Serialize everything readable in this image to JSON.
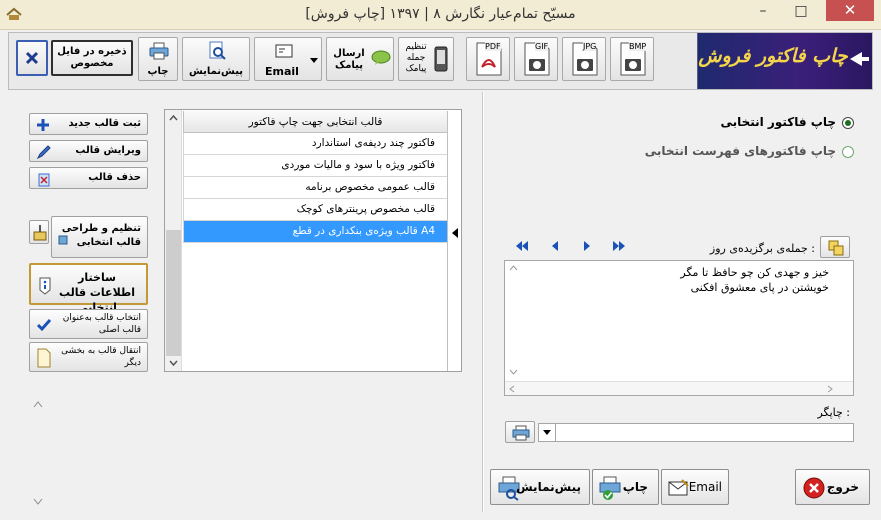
{
  "window": {
    "title": "مسیّح تمام‌عیار نگارش ۸ | ۱۳۹۷ [چاپ فروش]",
    "minimize_glyph": "–",
    "maximize_glyph": "□",
    "close_glyph": "✕"
  },
  "toolbar": {
    "save_special": "ذخیره در فایل مخصوص",
    "print": "چاپ",
    "preview": "پیش‌نمایش",
    "email": "Email",
    "send_sms": "ارسال پیامک",
    "sms_setup": "تنظیم جمله پیامک",
    "pdf": "PDF",
    "gif": "GIF",
    "jpg": "JPG",
    "bmp": "BMP",
    "brand": "چاپ فاکتور فروش"
  },
  "side_buttons": {
    "new_template": "ثبت قالب جدید",
    "edit_template": "ویرایش قالب",
    "delete_template": "حذف قالب",
    "design_setup": "تنظیم و طراحی قالب انتخابی",
    "template_info": "ساختار اطلاعات قالب انتخابی",
    "set_main": "انتخاب قالب به‌عنوان قالب اصلی",
    "move_template": "انتقال قالب به بخشی دیگر"
  },
  "template_list": {
    "header": "قالب انتخابی جهت چاپ فاکتور",
    "rows": [
      "فاکتور چند ردیفه‌ی استاندارد",
      "فاکتور ویژه با سود و مالیات موردی",
      "قالب عمومی مخصوص برنامه",
      "قالب مخصوص پرینترهای کوچک",
      "قالب ویژه‌ی بنکداری در قطع A4"
    ],
    "selected_index": 4
  },
  "print_options": {
    "selected_invoice": "چاپ فاکتور انتخابی",
    "listed_invoices": "چاپ فاکتورهای فهرست انتخابی",
    "selected": "selected_invoice"
  },
  "quote": {
    "label": "جمله‌ی برگزیده‌ی روز :",
    "text": "خیز و جهدی کن چو حافظ تا مگر\nخویشتن در پای معشوق افکنی"
  },
  "printer": {
    "label": "چاپگر :",
    "value": ""
  },
  "bottom_buttons": {
    "exit": "خروج",
    "email": "Email",
    "print": "چاپ",
    "preview": "پیش‌نمایش"
  },
  "colors": {
    "selection": "#3399ff",
    "brand_bg": "#2a1f70",
    "brand_text": "#f5d64a",
    "close_red": "#c75050"
  }
}
